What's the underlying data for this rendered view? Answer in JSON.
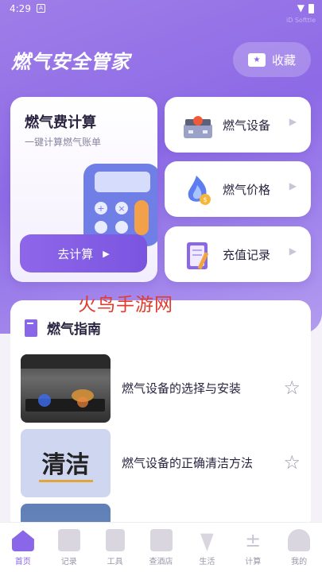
{
  "status": {
    "time": "4:29",
    "watermark": "iD Softtle"
  },
  "header": {
    "title": "燃气安全管家",
    "favorite_label": "收藏"
  },
  "calculator": {
    "title": "燃气费计算",
    "subtitle": "一键计算燃气账单",
    "button_label": "去计算"
  },
  "side_cards": [
    {
      "label": "燃气设备"
    },
    {
      "label": "燃气价格"
    },
    {
      "label": "充值记录"
    }
  ],
  "overlay_text": "火鸟手游网",
  "guide": {
    "title": "燃气指南",
    "items": [
      {
        "title": "燃气设备的选择与安装"
      },
      {
        "title": "燃气设备的正确清洁方法",
        "thumb_text": "清洁"
      },
      {
        "title": ""
      }
    ]
  },
  "tabs": [
    {
      "label": "首页",
      "icon": "home-icon",
      "active": true
    },
    {
      "label": "记录",
      "icon": "bookmark-icon"
    },
    {
      "label": "工具",
      "icon": "clipboard-icon"
    },
    {
      "label": "查酒店",
      "icon": "bookmark-icon"
    },
    {
      "label": "生活",
      "icon": "carrot-icon"
    },
    {
      "label": "计算",
      "icon": "calculator-icon"
    },
    {
      "label": "我的",
      "icon": "user-icon"
    }
  ],
  "colors": {
    "accent": "#8a66e8",
    "hero": "#9f7ee8"
  }
}
